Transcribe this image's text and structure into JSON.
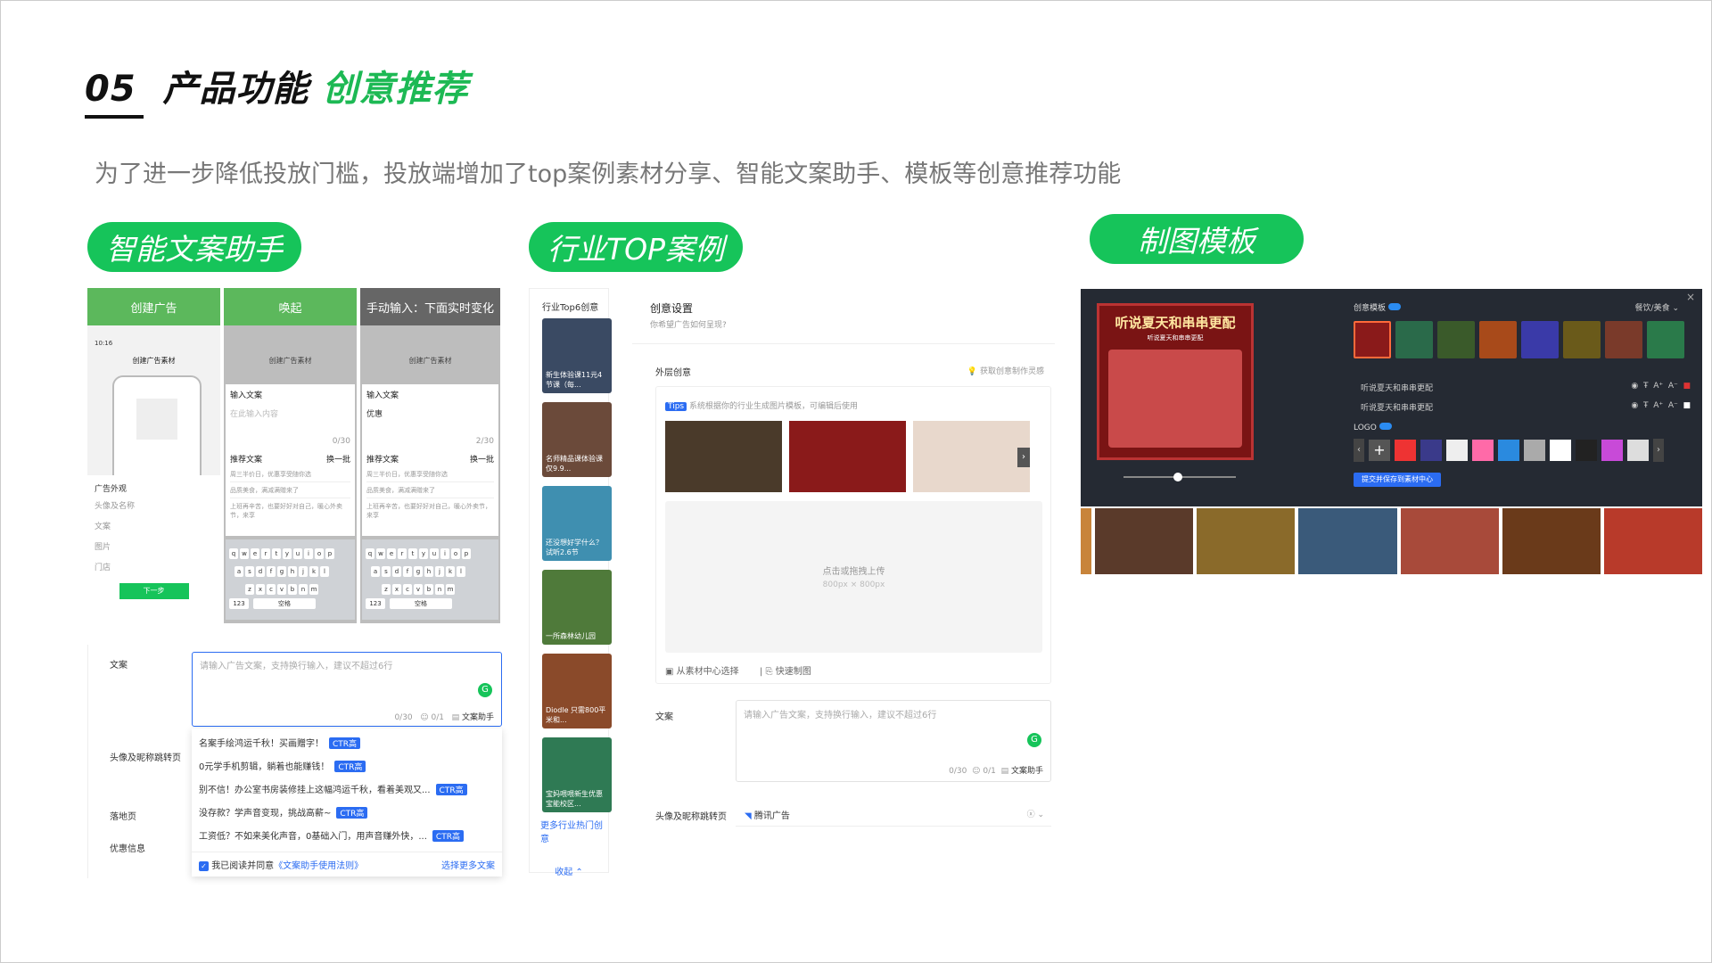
{
  "header": {
    "number": "05",
    "title_main": "产品功能",
    "title_hl": "创意推荐",
    "subtitle": "为了进一步降低投放门槛，投放端增加了top案例素材分享、智能文案助手、模板等创意推荐功能"
  },
  "sections": {
    "copy_assistant": "智能文案助手",
    "top_cases": "行业TOP案例",
    "templates": "制图模板"
  },
  "mobile": {
    "steps": [
      "创建广告",
      "唤起",
      "手动输入：下面实时变化"
    ],
    "screen_title": "创建广告素材",
    "input_title": "输入文案",
    "input_placeholder": "在此输入内容",
    "typed_text": "优惠",
    "counter": "0/30",
    "counter2": "2/30",
    "rec_label": "推荐文案",
    "refresh": "换一批",
    "rec_lines": [
      "周三半价日，优惠享受随你选",
      "品质美食，满减满赠来了",
      "上班再辛苦，也要好好对自己，暖心外卖节，来享"
    ],
    "form_items": [
      "广告外观",
      "头像及名称",
      "文案",
      "图片",
      "门店"
    ],
    "next_btn": "下一步",
    "space": "空格",
    "num": "123"
  },
  "copy_form": {
    "label_copy": "文案",
    "placeholder": "请输入广告文案，支持换行输入，建议不超过6行",
    "counter": "0/30",
    "emoji": "0/1",
    "assistant_btn": "文案助手",
    "label_avatar": "头像及昵称跳转页",
    "label_landing": "落地页",
    "label_promo": "优惠信息",
    "ctr_tag": "CTR高",
    "suggestions": [
      "名案手绘鸿运千秋！买画赠字！",
      "0元学手机剪辑，躺着也能赚钱！",
      "别不信！办公室书房装修挂上这幅鸿运千秋，看着美观又...",
      "没存款？学声音变现，挑战高薪~",
      "工资低？不如来美化声音，0基础入门，用声音赚外快，..."
    ],
    "agree": "我已阅读并同意",
    "agree_link": "《文案助手使用法则》",
    "more": "选择更多文案"
  },
  "top_panel": {
    "sidebar_title": "行业Top6创意",
    "cards": [
      "新生体验课11元4节课（每...",
      "名师精品课体验课 仅9.9...",
      "还没想好学什么？试听2.6节",
      "一所森林幼儿园",
      "Diodle 只需800平米和...",
      "宝妈喂喂新生优惠 宝能校区..."
    ],
    "more_link": "更多行业热门创意",
    "collapse": "收起",
    "settings_title": "创意设置",
    "settings_sub": "你希望广告如何呈现?",
    "appearance": "外层创意",
    "inspire": "获取创意制作灵感",
    "tips_tag": "Tips",
    "tips_text": "系统根据你的行业生成图片模板，可编辑后使用",
    "upload_text": "点击或拖拽上传",
    "upload_size": "800px × 800px",
    "from_library": "从素材中心选择",
    "quick_make": "快速制图",
    "label_copy": "文案",
    "placeholder": "请输入广告文案，支持换行输入，建议不超过6行",
    "counter": "0/30",
    "emoji": "0/1",
    "assistant_btn": "文案助手",
    "label_avatar": "头像及昵称跳转页",
    "brand": "腾讯广告"
  },
  "template_panel": {
    "poster_title": "听说夏天和串串更配",
    "poster_sub": "听说夏天和串串更配",
    "template_label": "创意模板",
    "category": "餐饮/美食",
    "text_row1": "听说夏天和串串更配",
    "text_row2": "听说夏天和串串更配",
    "logo_label": "LOGO",
    "save_btn": "提交并保存到素材中心"
  },
  "colors": {
    "green": "#16c45a",
    "blue": "#2b6cf2",
    "dark": "#252a33"
  }
}
